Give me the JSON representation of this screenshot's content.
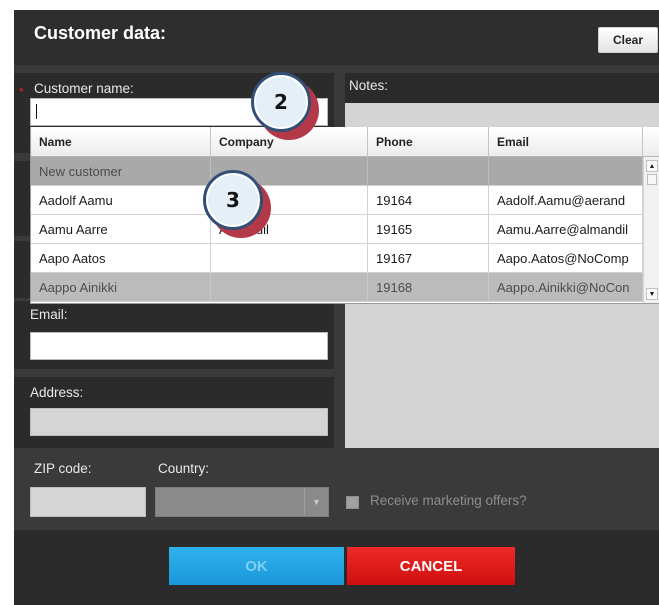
{
  "dialog": {
    "title": "Customer data:",
    "clear_label": "Clear"
  },
  "fields": {
    "customer_name": {
      "label": "Customer name:",
      "value": "",
      "required_marker": "●"
    },
    "notes": {
      "label": "Notes:",
      "value": ""
    },
    "email": {
      "label": "Email:",
      "value": ""
    },
    "address": {
      "label": "Address:",
      "value": ""
    },
    "zip": {
      "label": "ZIP code:",
      "value": ""
    },
    "country": {
      "label": "Country:",
      "selected": "",
      "arrow": "▼"
    },
    "marketing": {
      "label": "Receive marketing offers?",
      "checked": false
    }
  },
  "customer_dropdown": {
    "columns": [
      "Name",
      "Company",
      "Phone",
      "Email"
    ],
    "rows": [
      {
        "name": "New customer",
        "company": "",
        "phone": "",
        "email": ""
      },
      {
        "name": "Aadolf Aamu",
        "company": "",
        "phone": "19164",
        "email": "Aadolf.Aamu@aerand"
      },
      {
        "name": "Aamu Aarre",
        "company": "Almandil",
        "phone": "19165",
        "email": "Aamu.Aarre@almandil"
      },
      {
        "name": "Aapo Aatos",
        "company": "",
        "phone": "19167",
        "email": "Aapo.Aatos@NoComp"
      },
      {
        "name": "Aappo Ainikki",
        "company": "",
        "phone": "19168",
        "email": "Aappo.Ainikki@NoCon"
      }
    ],
    "selected_row": 4,
    "scroll_up": "▲",
    "scroll_down": "▼"
  },
  "callouts": [
    "2",
    "3"
  ],
  "footer": {
    "ok_label": "OK",
    "cancel_label": "CANCEL"
  },
  "colors": {
    "ok": "#1a9ad9",
    "cancel": "#e01818",
    "callout_border": "#334f77",
    "callout_shadow": "#b33848"
  }
}
